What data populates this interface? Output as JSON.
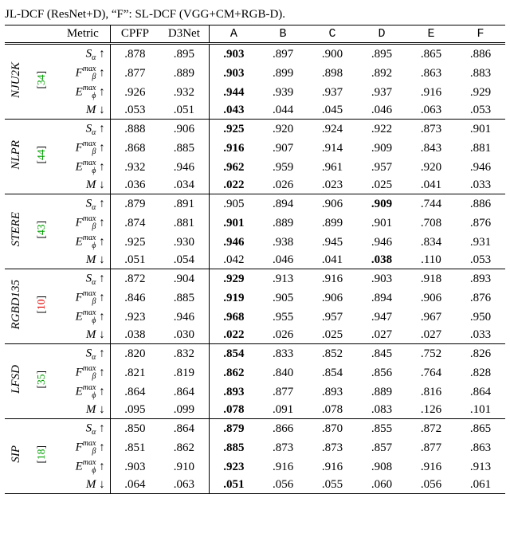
{
  "caption_tail": "JL-DCF (ResNet+D), “F”: SL-DCF (VGG+CM+RGB-D).",
  "header": {
    "metric": "Metric",
    "cols": [
      "CPFP",
      "D3Net",
      "A",
      "B",
      "C",
      "D",
      "E",
      "F"
    ]
  },
  "metrics": [
    {
      "label": "S",
      "sub": "α",
      "sup": "",
      "arrow": "↑"
    },
    {
      "label": "F",
      "sub": "β",
      "sup": "max",
      "arrow": "↑"
    },
    {
      "label": "E",
      "sub": "ϕ",
      "sup": "max",
      "arrow": "↑"
    },
    {
      "label": "M",
      "sub": "",
      "sup": "",
      "arrow": "↓"
    }
  ],
  "chart_data": {
    "type": "table",
    "datasets": [
      {
        "name": "NJU2K",
        "cite_num": "34",
        "cite_color": "green",
        "rows": [
          {
            "values": [
              ".878",
              ".895",
              ".903",
              ".897",
              ".900",
              ".895",
              ".865",
              ".886"
            ],
            "bold_idx": 2
          },
          {
            "values": [
              ".877",
              ".889",
              ".903",
              ".899",
              ".898",
              ".892",
              ".863",
              ".883"
            ],
            "bold_idx": 2
          },
          {
            "values": [
              ".926",
              ".932",
              ".944",
              ".939",
              ".937",
              ".937",
              ".916",
              ".929"
            ],
            "bold_idx": 2
          },
          {
            "values": [
              ".053",
              ".051",
              ".043",
              ".044",
              ".045",
              ".046",
              ".063",
              ".053"
            ],
            "bold_idx": 2
          }
        ]
      },
      {
        "name": "NLPR",
        "cite_num": "44",
        "cite_color": "green",
        "rows": [
          {
            "values": [
              ".888",
              ".906",
              ".925",
              ".920",
              ".924",
              ".922",
              ".873",
              ".901"
            ],
            "bold_idx": 2
          },
          {
            "values": [
              ".868",
              ".885",
              ".916",
              ".907",
              ".914",
              ".909",
              ".843",
              ".881"
            ],
            "bold_idx": 2
          },
          {
            "values": [
              ".932",
              ".946",
              ".962",
              ".959",
              ".961",
              ".957",
              ".920",
              ".946"
            ],
            "bold_idx": 2
          },
          {
            "values": [
              ".036",
              ".034",
              ".022",
              ".026",
              ".023",
              ".025",
              ".041",
              ".033"
            ],
            "bold_idx": 2
          }
        ]
      },
      {
        "name": "STERE",
        "cite_num": "43",
        "cite_color": "green",
        "rows": [
          {
            "values": [
              ".879",
              ".891",
              ".905",
              ".894",
              ".906",
              ".909",
              ".744",
              ".886"
            ],
            "bold_idx": 5
          },
          {
            "values": [
              ".874",
              ".881",
              ".901",
              ".889",
              ".899",
              ".901",
              ".708",
              ".876"
            ],
            "bold_idx": 2
          },
          {
            "values": [
              ".925",
              ".930",
              ".946",
              ".938",
              ".945",
              ".946",
              ".834",
              ".931"
            ],
            "bold_idx": 2
          },
          {
            "values": [
              ".051",
              ".054",
              ".042",
              ".046",
              ".041",
              ".038",
              ".110",
              ".053"
            ],
            "bold_idx": 5
          }
        ]
      },
      {
        "name": "RGBD135",
        "cite_num": "10",
        "cite_color": "red",
        "rows": [
          {
            "values": [
              ".872",
              ".904",
              ".929",
              ".913",
              ".916",
              ".903",
              ".918",
              ".893"
            ],
            "bold_idx": 2
          },
          {
            "values": [
              ".846",
              ".885",
              ".919",
              ".905",
              ".906",
              ".894",
              ".906",
              ".876"
            ],
            "bold_idx": 2
          },
          {
            "values": [
              ".923",
              ".946",
              ".968",
              ".955",
              ".957",
              ".947",
              ".967",
              ".950"
            ],
            "bold_idx": 2
          },
          {
            "values": [
              ".038",
              ".030",
              ".022",
              ".026",
              ".025",
              ".027",
              ".027",
              ".033"
            ],
            "bold_idx": 2
          }
        ]
      },
      {
        "name": "LFSD",
        "cite_num": "35",
        "cite_color": "green",
        "rows": [
          {
            "values": [
              ".820",
              ".832",
              ".854",
              ".833",
              ".852",
              ".845",
              ".752",
              ".826"
            ],
            "bold_idx": 2
          },
          {
            "values": [
              ".821",
              ".819",
              ".862",
              ".840",
              ".854",
              ".856",
              ".764",
              ".828"
            ],
            "bold_idx": 2
          },
          {
            "values": [
              ".864",
              ".864",
              ".893",
              ".877",
              ".893",
              ".889",
              ".816",
              ".864"
            ],
            "bold_idx": 2
          },
          {
            "values": [
              ".095",
              ".099",
              ".078",
              ".091",
              ".078",
              ".083",
              ".126",
              ".101"
            ],
            "bold_idx": 2
          }
        ]
      },
      {
        "name": "SIP",
        "cite_num": "18",
        "cite_color": "green",
        "rows": [
          {
            "values": [
              ".850",
              ".864",
              ".879",
              ".866",
              ".870",
              ".855",
              ".872",
              ".865"
            ],
            "bold_idx": 2
          },
          {
            "values": [
              ".851",
              ".862",
              ".885",
              ".873",
              ".873",
              ".857",
              ".877",
              ".863"
            ],
            "bold_idx": 2
          },
          {
            "values": [
              ".903",
              ".910",
              ".923",
              ".916",
              ".916",
              ".908",
              ".916",
              ".913"
            ],
            "bold_idx": 2
          },
          {
            "values": [
              ".064",
              ".063",
              ".051",
              ".056",
              ".055",
              ".060",
              ".056",
              ".061"
            ],
            "bold_idx": 2
          }
        ]
      }
    ]
  }
}
